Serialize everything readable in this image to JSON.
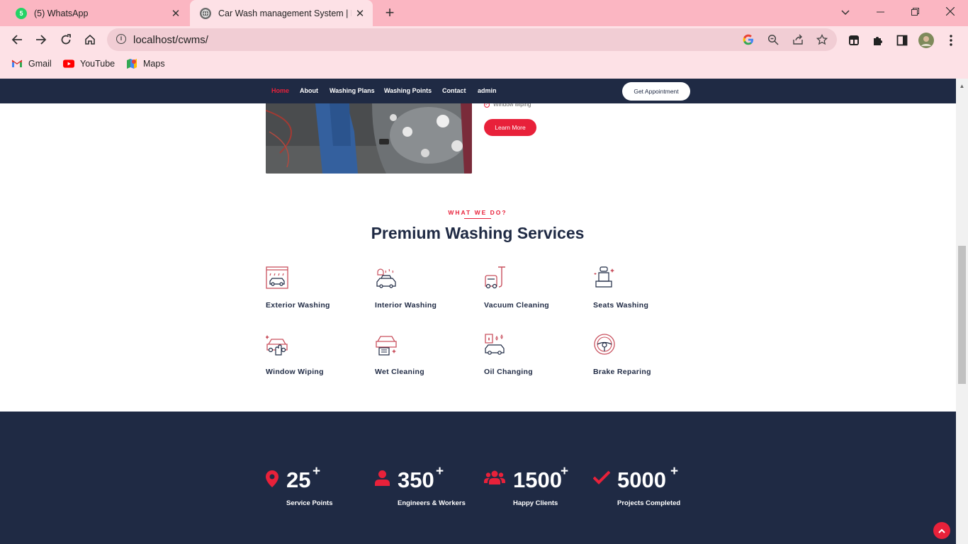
{
  "browser": {
    "tabs": [
      {
        "title": "(5) WhatsApp",
        "badge": "5",
        "state": "inactive"
      },
      {
        "title": "Car Wash management System | Ho",
        "state": "active"
      }
    ],
    "url": "localhost/cwms/",
    "bookmarks": [
      "Gmail",
      "YouTube",
      "Maps"
    ]
  },
  "site": {
    "nav": [
      "Home",
      "About",
      "Washing Plans",
      "Washing Points",
      "Contact",
      "admin"
    ],
    "appointment_label": "Get Appointment",
    "hero": {
      "check_item": "Window wiping",
      "learn_more": "Learn More"
    },
    "services": {
      "eyebrow": "WHAT WE DO?",
      "title": "Premium Washing Services",
      "items": [
        {
          "label": "Exterior Washing",
          "icon": "car-wash-icon"
        },
        {
          "label": "Interior Washing",
          "icon": "interior-wash-icon"
        },
        {
          "label": "Vacuum Cleaning",
          "icon": "vacuum-icon"
        },
        {
          "label": "Seats Washing",
          "icon": "seat-icon"
        },
        {
          "label": "Window Wiping",
          "icon": "window-wipe-icon"
        },
        {
          "label": "Wet Cleaning",
          "icon": "wet-clean-icon"
        },
        {
          "label": "Oil Changing",
          "icon": "oil-change-icon"
        },
        {
          "label": "Brake Reparing",
          "icon": "brake-icon"
        }
      ]
    },
    "stats": [
      {
        "value": "25",
        "suffix": "+",
        "label": "Service Points",
        "icon": "map-pin-icon"
      },
      {
        "value": "350",
        "suffix": "+",
        "label": "Engineers & Workers",
        "icon": "user-icon"
      },
      {
        "value": "1500",
        "suffix": "+",
        "label": "Happy Clients",
        "icon": "users-icon"
      },
      {
        "value": "5000",
        "suffix": "+",
        "label": "Projects Completed",
        "icon": "check-icon"
      }
    ]
  },
  "colors": {
    "accent": "#e8213a",
    "navy": "#1f2a44",
    "chrome_pink": "#fbb6c2",
    "chrome_light": "#fde1e6"
  }
}
